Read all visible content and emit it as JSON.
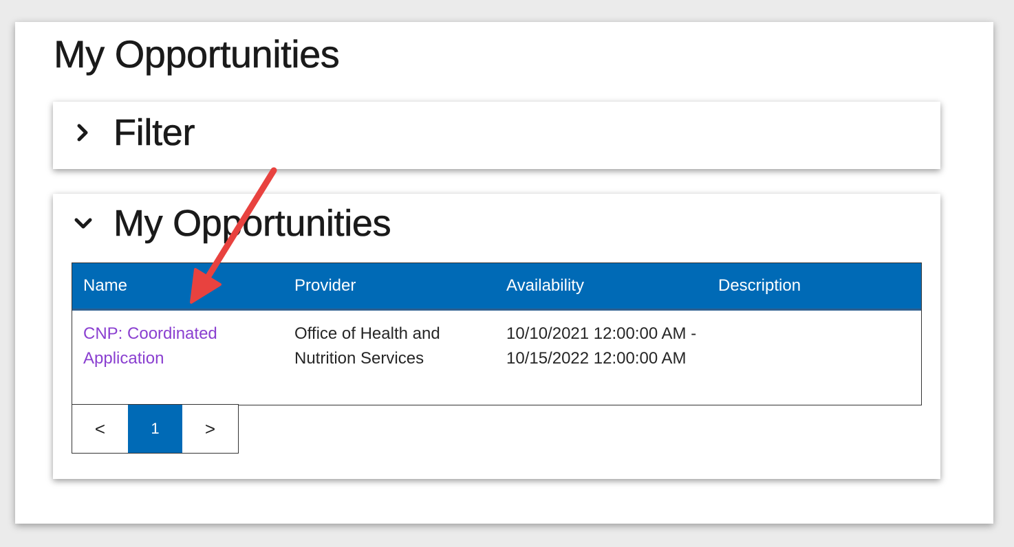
{
  "page": {
    "title": "My Opportunities"
  },
  "filter_panel": {
    "title": "Filter",
    "expanded": false,
    "chevron_icon": "chevron-right-icon"
  },
  "opportunities_panel": {
    "title": "My Opportunities",
    "expanded": true,
    "chevron_icon": "chevron-down-icon"
  },
  "table": {
    "columns": [
      "Name",
      "Provider",
      "Availability",
      "Description"
    ],
    "rows": [
      {
        "name": "CNP: Coordinated Application",
        "provider": "Office of Health and Nutrition Services",
        "availability": "10/10/2021 12:00:00 AM - 10/15/2022 12:00:00 AM",
        "description": ""
      }
    ]
  },
  "pagination": {
    "prev_label": "<",
    "current_page": "1",
    "next_label": ">"
  },
  "colors": {
    "header_blue": "#006ab6",
    "link_purple": "#8a3fd0",
    "annotation_arrow": "#e8423f"
  }
}
